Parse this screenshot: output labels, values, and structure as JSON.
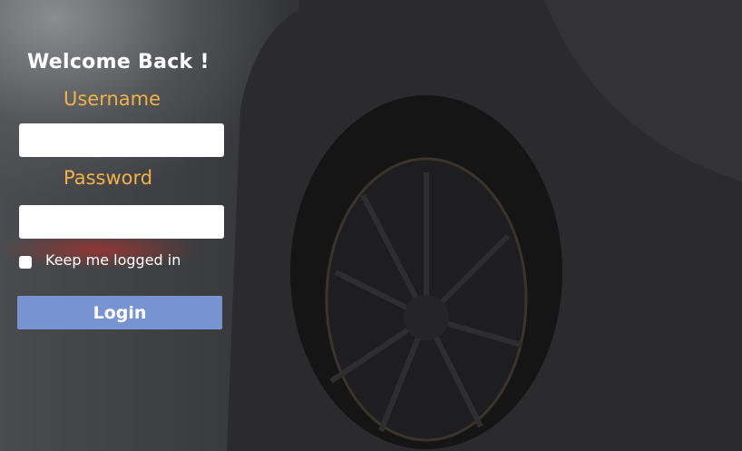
{
  "form": {
    "title": "Welcome Back !",
    "username_label": "Username",
    "username_value": "",
    "password_label": "Password",
    "password_value": "",
    "keep_logged_in_label": "Keep me logged in",
    "keep_logged_in_checked": false,
    "login_label": "Login"
  },
  "colors": {
    "label": "#f1b24a",
    "button": "#7793d2"
  }
}
